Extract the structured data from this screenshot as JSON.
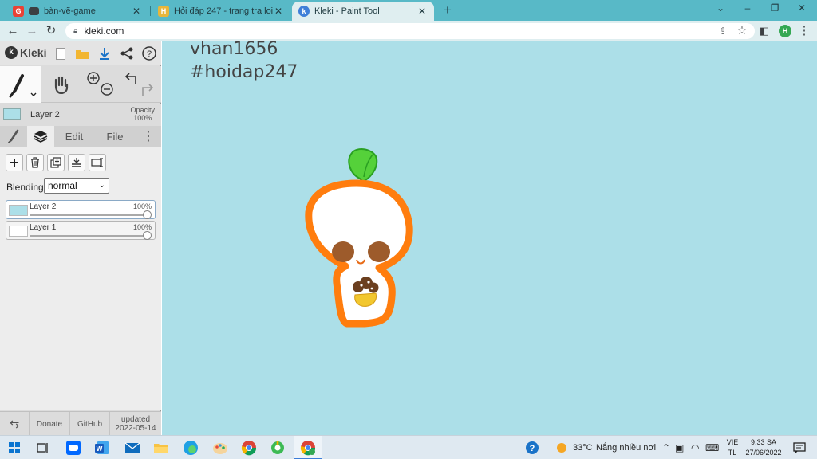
{
  "browser": {
    "tabs": [
      {
        "title": "bàn-vẽ-game",
        "close": "✕"
      },
      {
        "title": "Hỏi đáp 247 - trang tra loi",
        "close": "✕"
      },
      {
        "title": "Kleki - Paint Tool",
        "close": "✕"
      }
    ],
    "new_tab": "+",
    "url": "kleki.com",
    "profile_initial": "H",
    "window_controls": {
      "minimize": "–",
      "restore": "❐",
      "close": "✕"
    }
  },
  "kleki": {
    "logo": "Kleki",
    "current_layer": "Layer 2",
    "opacity_label": "Opacity",
    "opacity_value": "100%",
    "tabs": {
      "edit": "Edit",
      "file": "File"
    },
    "blending_label": "Blending",
    "blending_value": "normal",
    "layers": [
      {
        "name": "Layer 2",
        "opacity": "100%",
        "opacity_value": 100,
        "thumb_color": "#acdfe8"
      },
      {
        "name": "Layer 1",
        "opacity": "100%",
        "opacity_value": 100,
        "thumb_color": "#ffffff"
      }
    ],
    "footer": {
      "swap": "⇆",
      "donate": "Donate",
      "github": "GitHub",
      "updated_label": "updated",
      "updated_date": "2022-05-14"
    },
    "canvas_bg": "#acdfe8",
    "canvas_text": [
      "vhan1656",
      "#hoidap247"
    ]
  },
  "taskbar": {
    "weather_temp": "33°C",
    "weather_text": "Nắng nhiều nơi",
    "lang_top": "VIE",
    "lang_bottom": "TL",
    "time": "9:33 SA",
    "date": "27/06/2022"
  }
}
